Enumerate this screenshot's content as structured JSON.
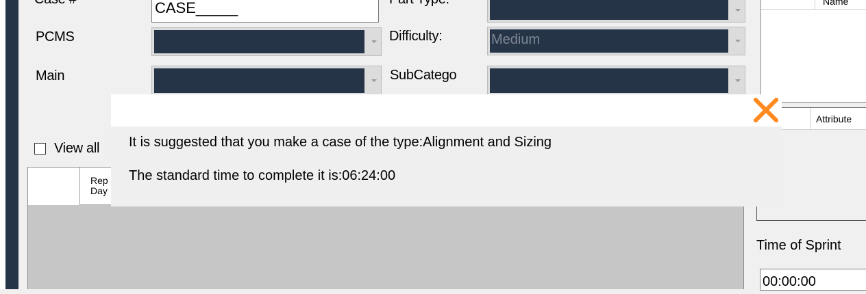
{
  "form": {
    "case_label": "Case #",
    "case_value": "CASE_____",
    "part_type_label": "Part Type:",
    "pcms_label": "PCMS",
    "difficulty_label": "Difficulty:",
    "difficulty_value": "Medium",
    "main_label": "Main",
    "subcategory_label": "SubCatego",
    "view_all_label": "View all"
  },
  "grid": {
    "columns": [
      "Rep Day"
    ]
  },
  "right_panel": {
    "top_header": "Name",
    "attr_header": "Attribute",
    "sprint_label": "Time of Sprint",
    "sprint_value": "00:00:00"
  },
  "dialog": {
    "line1": "It is suggested that you make a case of the type:Alignment and Sizing",
    "line2": "The standard time to complete it is:06:24:00"
  },
  "colors": {
    "dark_navy": "#263448",
    "close_orange": "#ff8a1f"
  }
}
